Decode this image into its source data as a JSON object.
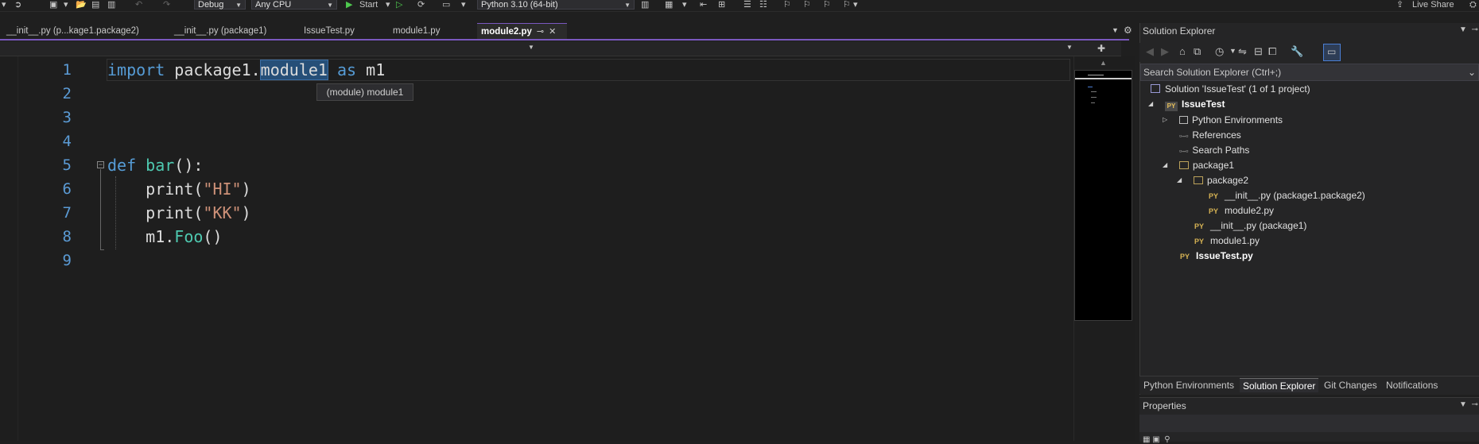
{
  "toolbar": {
    "configuration": "Debug",
    "platform": "Any CPU",
    "start_label": "Start",
    "interpreter": "Python 3.10 (64-bit)",
    "live_share": "Live Share"
  },
  "tabs": [
    {
      "label": "__init__.py (p...kage1.package2)"
    },
    {
      "label": "__init__.py (package1)"
    },
    {
      "label": "IssueTest.py"
    },
    {
      "label": "module1.py"
    },
    {
      "label": "module2.py",
      "active": true
    }
  ],
  "editor": {
    "line_numbers": [
      "1",
      "2",
      "3",
      "4",
      "5",
      "6",
      "7",
      "8",
      "9"
    ],
    "line1": {
      "kw_import": "import",
      "pkg": " package1.",
      "mod": "module1",
      "kw_as": "as",
      "alias": " m1"
    },
    "line5": {
      "kw_def": "def",
      "fname": " bar",
      "rest": "():"
    },
    "line6": {
      "call": "    print(",
      "arg": "\"HI\"",
      "close": ")"
    },
    "line7": {
      "call": "    print(",
      "arg": "\"KK\"",
      "close": ")"
    },
    "line8": {
      "obj": "    m1.",
      "method": "Foo",
      "close": "()"
    },
    "tooltip": "(module) module1"
  },
  "solution_explorer": {
    "title": "Solution Explorer",
    "search_placeholder": "Search Solution Explorer (Ctrl+;)",
    "tree": {
      "solution": "Solution 'IssueTest' (1 of 1 project)",
      "project": "IssueTest",
      "python_envs": "Python Environments",
      "references": "References",
      "search_paths": "Search Paths",
      "package1": "package1",
      "package2": "package2",
      "init_pkg2": "__init__.py (package1.package2)",
      "module2": "module2.py",
      "init_pkg1": "__init__.py (package1)",
      "module1": "module1.py",
      "issuetest": "IssueTest.py",
      "py_badge": "PY"
    },
    "bottom_tabs": [
      "Python Environments",
      "Solution Explorer",
      "Git Changes",
      "Notifications"
    ]
  },
  "properties": {
    "title": "Properties"
  }
}
